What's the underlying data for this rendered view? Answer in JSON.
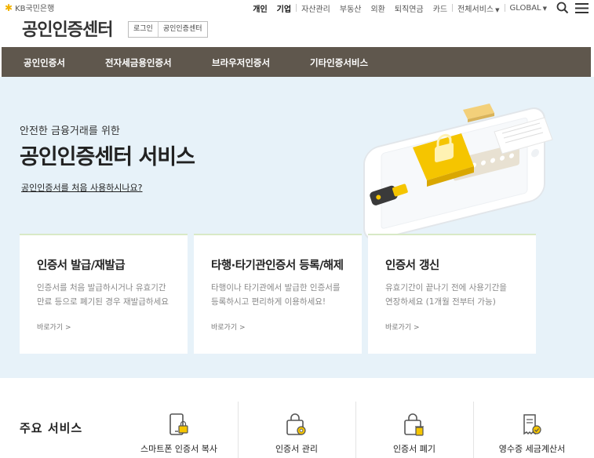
{
  "brand": {
    "name": "KB국민은행"
  },
  "site": {
    "title": "공인인증센터"
  },
  "sub_links": [
    "로그인",
    "공인인증센터"
  ],
  "top_nav": {
    "primary": [
      "개인",
      "기업"
    ],
    "secondary": [
      "자산관리",
      "부동산",
      "외환",
      "퇴직연금",
      "카드"
    ],
    "all_services": "전체서비스",
    "global": "GLOBAL"
  },
  "main_nav": [
    "공인인증서",
    "전자세금용인증서",
    "브라우저인증서",
    "기타인증서비스"
  ],
  "hero": {
    "subtitle": "안전한 금융거래를 위한",
    "title": "공인인증센터 서비스",
    "link": "공인인증서를 처음 사용하시나요?"
  },
  "cards": [
    {
      "title": "인증서 발급/재발급",
      "desc": [
        "인증서를 처음 발급하시거나 유효기간",
        "만료 등으로 폐기된 경우 재발급하세요"
      ],
      "link": "바로가기 >"
    },
    {
      "title": "타행·타기관인증서 등록/해제",
      "desc": [
        "타행이나 타기관에서 발급한 인증서를",
        "등록하시고 편리하게 이용하세요!"
      ],
      "link": "바로가기 >"
    },
    {
      "title": "인증서 갱신",
      "desc": [
        "유효기간이 끝나기 전에 사용기간을",
        "연장하세요 (1개월 전부터 가능)"
      ],
      "link": "바로가기 >"
    }
  ],
  "services": {
    "title": "주요 서비스",
    "items": [
      {
        "label": "스마트폰 인증서 복사",
        "icon": "phone-lock-icon"
      },
      {
        "label": "인증서 관리",
        "icon": "bag-gear-icon"
      },
      {
        "label": "인증서 폐기",
        "icon": "bag-trash-icon"
      },
      {
        "label": "영수증 세금계산서",
        "icon": "receipt-check-icon"
      }
    ]
  },
  "colors": {
    "nav_bg": "#5f574d",
    "hero_bg": "#e7f2f9",
    "accent_yellow": "#f2c200",
    "card_border": "#d8e9c6"
  }
}
